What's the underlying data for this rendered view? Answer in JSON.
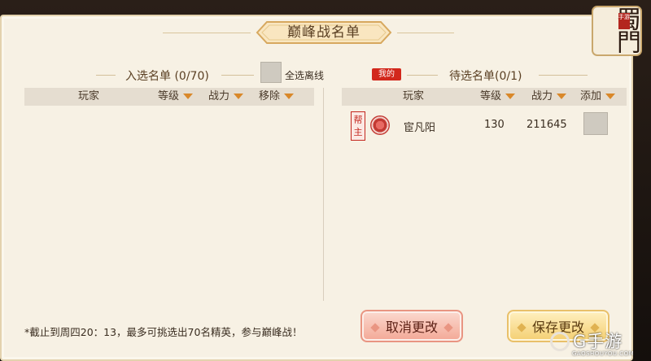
{
  "dialog": {
    "title": "巅峰战名单",
    "logo_text": "蜀門",
    "logo_seal": "手游"
  },
  "left": {
    "title": "入选名单 (0/70)",
    "select_all_offline": "全选离线",
    "columns": [
      {
        "label": "玩家",
        "sortable": false
      },
      {
        "label": "等级",
        "sortable": true
      },
      {
        "label": "战力",
        "sortable": true
      },
      {
        "label": "移除",
        "sortable": true
      }
    ],
    "rows": []
  },
  "right": {
    "mine_tag": "我的",
    "title": "待选名单(0/1)",
    "columns": [
      {
        "label": "玩家",
        "sortable": false
      },
      {
        "label": "等级",
        "sortable": true
      },
      {
        "label": "战力",
        "sortable": true
      },
      {
        "label": "添加",
        "sortable": true
      }
    ],
    "rows": [
      {
        "role": "帮主",
        "name": "宦凡阳",
        "level": "130",
        "power": "211645"
      }
    ]
  },
  "footnote": "*截止到周四20：13，最多可挑选出70名精英，参与巅峰战！",
  "buttons": {
    "cancel": "取消更改",
    "save": "保存更改"
  },
  "watermark": {
    "text": "G手游",
    "sub": "GAOSHOUYOU.COM"
  },
  "colors": {
    "accent_red": "#d2281c",
    "accent_orange": "#d9882a",
    "panel_bg": "#f7f1e4"
  }
}
